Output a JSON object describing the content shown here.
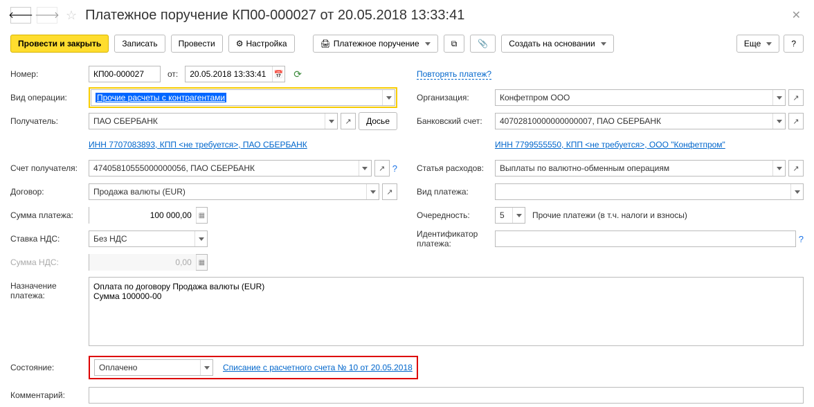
{
  "header": {
    "title": "Платежное поручение КП00-000027 от 20.05.2018 13:33:41"
  },
  "toolbar": {
    "post_close": "Провести и закрыть",
    "write": "Записать",
    "post": "Провести",
    "settings": "Настройка",
    "printform": "Платежное поручение",
    "create_based": "Создать на основании",
    "more": "Еще"
  },
  "left": {
    "number_label": "Номер:",
    "number": "КП00-000027",
    "from_label": "от:",
    "date": "20.05.2018 13:33:41",
    "optype_label": "Вид операции:",
    "optype": "Прочие расчеты с контрагентами",
    "recipient_label": "Получатель:",
    "recipient": "ПАО СБЕРБАНК",
    "dossier": "Досье",
    "inn_link": "ИНН 7707083893, КПП <не требуется>, ПАО СБЕРБАНК",
    "recipient_account_label": "Счет получателя:",
    "recipient_account": "47405810555000000056, ПАО СБЕРБАНК",
    "contract_label": "Договор:",
    "contract": "Продажа валюты (EUR)",
    "sum_label": "Сумма платежа:",
    "sum": "100 000,00",
    "vat_rate_label": "Ставка НДС:",
    "vat_rate": "Без НДС",
    "vat_sum_label": "Сумма НДС:",
    "vat_sum": "0,00"
  },
  "right": {
    "repeat_link": "Повторять платеж?",
    "org_label": "Организация:",
    "org": "Конфетпром ООО",
    "bank_account_label": "Банковский счет:",
    "bank_account": "40702810000000000007, ПАО СБЕРБАНК",
    "inn_link": "ИНН 7799555550, КПП <не требуется>, ООО \"Конфетпром\"",
    "expense_label": "Статья расходов:",
    "expense": "Выплаты по валютно-обменным операциям",
    "payment_kind_label": "Вид платежа:",
    "payment_kind": "",
    "priority_label": "Очередность:",
    "priority": "5",
    "priority_desc": "Прочие платежи (в т.ч. налоги и взносы)",
    "identifier_label": "Идентификатор платежа:",
    "identifier": ""
  },
  "purpose": {
    "label": "Назначение платежа:",
    "text": "Оплата по договору Продажа валюты (EUR)\nСумма 100000-00"
  },
  "state": {
    "label": "Состояние:",
    "value": "Оплачено",
    "link": "Списание с расчетного счета № 10 от 20.05.2018"
  },
  "comment": {
    "label": "Комментарий:"
  }
}
